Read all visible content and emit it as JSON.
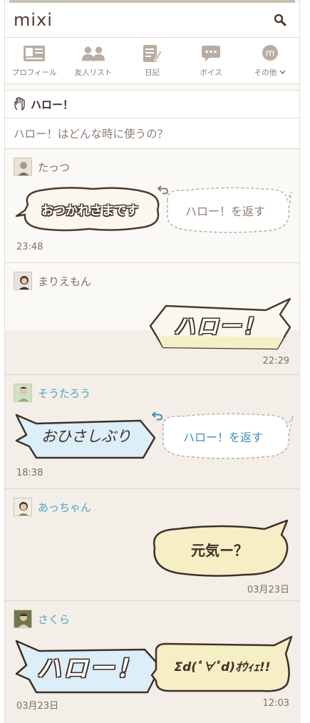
{
  "app": {
    "logo": "mixi"
  },
  "nav": [
    {
      "label": "プロフィール",
      "icon": "profile-card-icon"
    },
    {
      "label": "友人リスト",
      "icon": "friends-icon"
    },
    {
      "label": "日記",
      "icon": "diary-icon"
    },
    {
      "label": "ボイス",
      "icon": "voice-icon"
    },
    {
      "label": "その他",
      "icon": "mixi-more-icon"
    }
  ],
  "section": {
    "title": "ハロー！",
    "icon": "hand-icon"
  },
  "help_link": "ハロー！はどんな時に使うの？",
  "entries": [
    {
      "name": "たっつ",
      "sticker": "おつかれさまです",
      "reply": "ハロー！を返す",
      "time": "23:48"
    },
    {
      "name": "まりえもん",
      "sticker": "ハロー！",
      "time": "22:29"
    },
    {
      "name": "そうたろう",
      "sticker": "おひさしぶり",
      "reply": "ハロー！を返す",
      "time": "18:38"
    },
    {
      "name": "あっちゃん",
      "sticker": "元気ー？",
      "time": "03月23日"
    },
    {
      "name": "さくら",
      "sticker": "ハロー！",
      "reply_sticker": "Σd(ﾟ∀ﾟd)ｵｳｨｪ!!",
      "time_left": "03月23日",
      "time_right": "12:03"
    }
  ],
  "colors": {
    "link_blue": "#4ba6c6",
    "bubble_blue": "#dceef8",
    "bubble_yellow": "#f6efc6",
    "text_brown": "#5b4a3f"
  }
}
